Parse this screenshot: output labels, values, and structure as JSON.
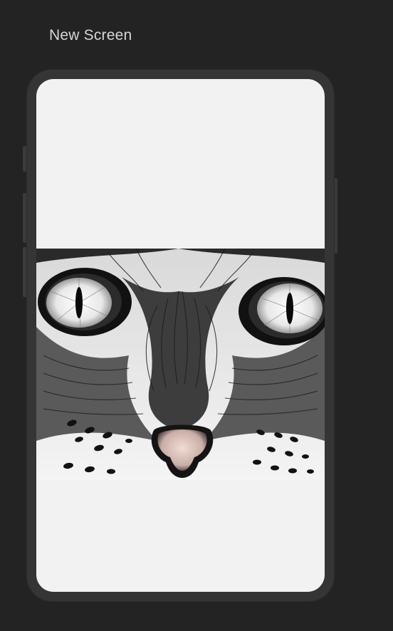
{
  "screen": {
    "title": "New Screen"
  },
  "device": {
    "frame_color": "#353535",
    "screen_color": "#f2f2f2"
  },
  "content": {
    "image": {
      "icon": "cat-face-illustration",
      "style": "black-and-white ink drawing"
    }
  }
}
